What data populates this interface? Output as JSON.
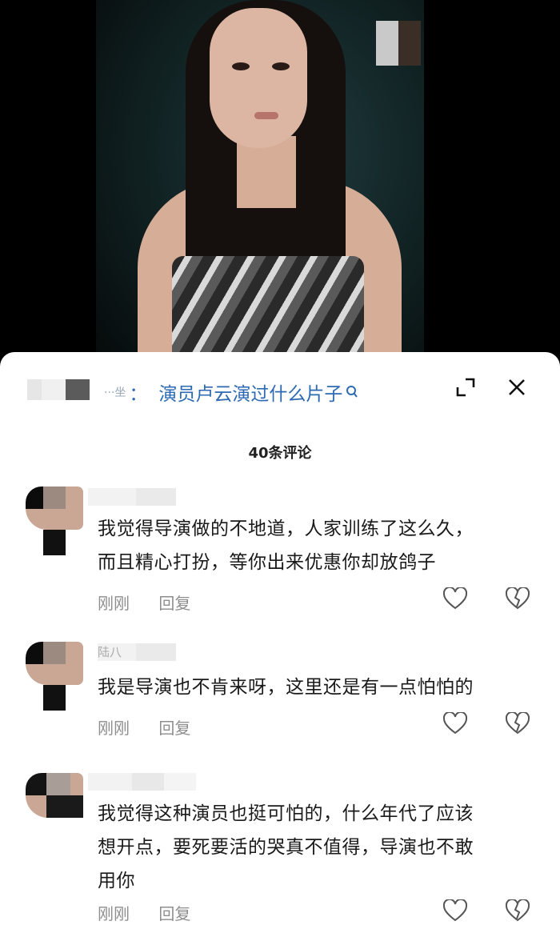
{
  "header": {
    "search_prefix": "···坐",
    "search_colon": "：",
    "search_query": "演员卢云演过什么片子",
    "search_icon": "search-icon",
    "expand_icon": "expand-icon",
    "close_icon": "close-icon"
  },
  "comment_count": "40条评论",
  "comments": [
    {
      "text_line1": "我觉得导演做的不地道，人家训练了这么久，",
      "text_line2": "而且精心打扮，等你出来优惠你却放鸽子",
      "text_line3": "",
      "time": "刚刚",
      "reply": "回复"
    },
    {
      "name_fragment": "陆八",
      "text_line1": "我是导演也不肯来呀，这里还是有一点怕怕的",
      "text_line2": "",
      "text_line3": "",
      "time": "刚刚",
      "reply": "回复"
    },
    {
      "text_line1": "我觉得这种演员也挺可怕的，什么年代了应该",
      "text_line2": "想开点，要死要活的哭真不值得，导演也不敢",
      "text_line3": "用你",
      "time": "刚刚",
      "reply": "回复"
    }
  ],
  "colors": {
    "link": "#2d6ab3",
    "meta": "#8e8e8e",
    "text": "#1a1a1a"
  }
}
